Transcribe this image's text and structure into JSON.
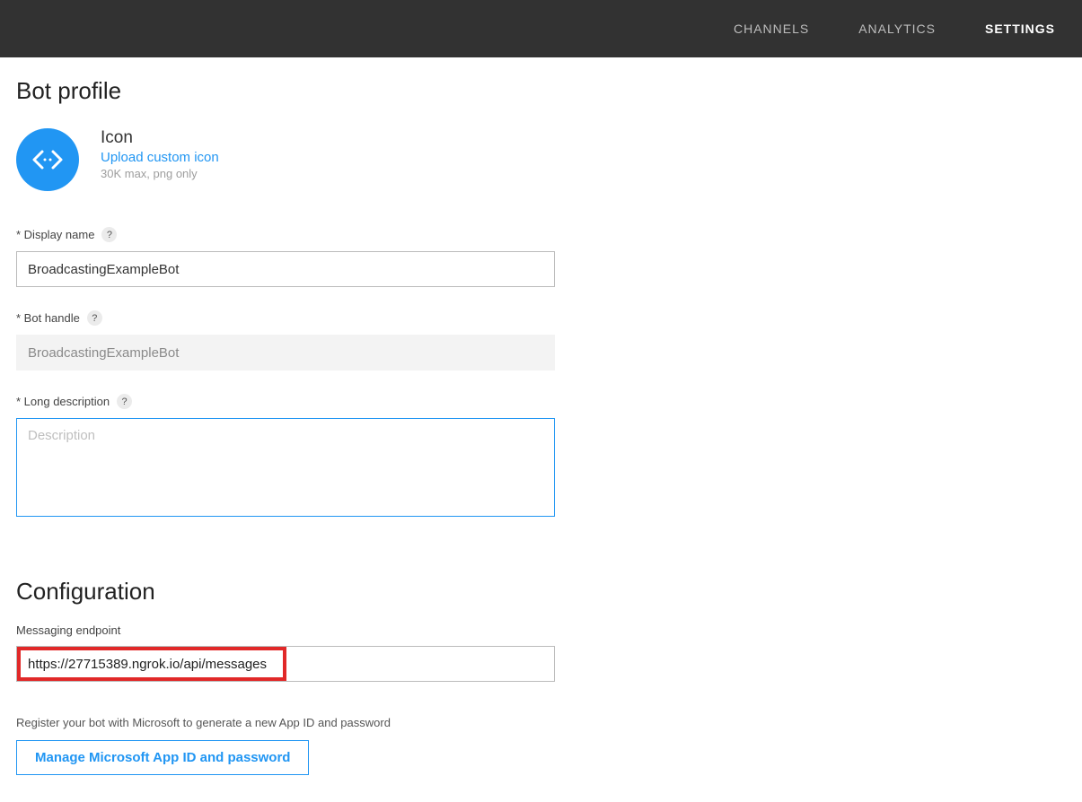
{
  "nav": {
    "channels": "Channels",
    "analytics": "Analytics",
    "settings": "Settings"
  },
  "profile": {
    "title": "Bot profile",
    "icon_label": "Icon",
    "upload_link": "Upload custom icon",
    "icon_hint": "30K max, png only",
    "display_name_label": "* Display name",
    "display_name_value": "BroadcastingExampleBot",
    "bot_handle_label": "* Bot handle",
    "bot_handle_value": "BroadcastingExampleBot",
    "long_desc_label": "* Long description",
    "long_desc_placeholder": "Description",
    "long_desc_value": ""
  },
  "config": {
    "title": "Configuration",
    "endpoint_label": "Messaging endpoint",
    "endpoint_value": "https://27715389.ngrok.io/api/messages",
    "register_hint": "Register your bot with Microsoft to generate a new App ID and password",
    "manage_button": "Manage Microsoft App ID and password"
  }
}
